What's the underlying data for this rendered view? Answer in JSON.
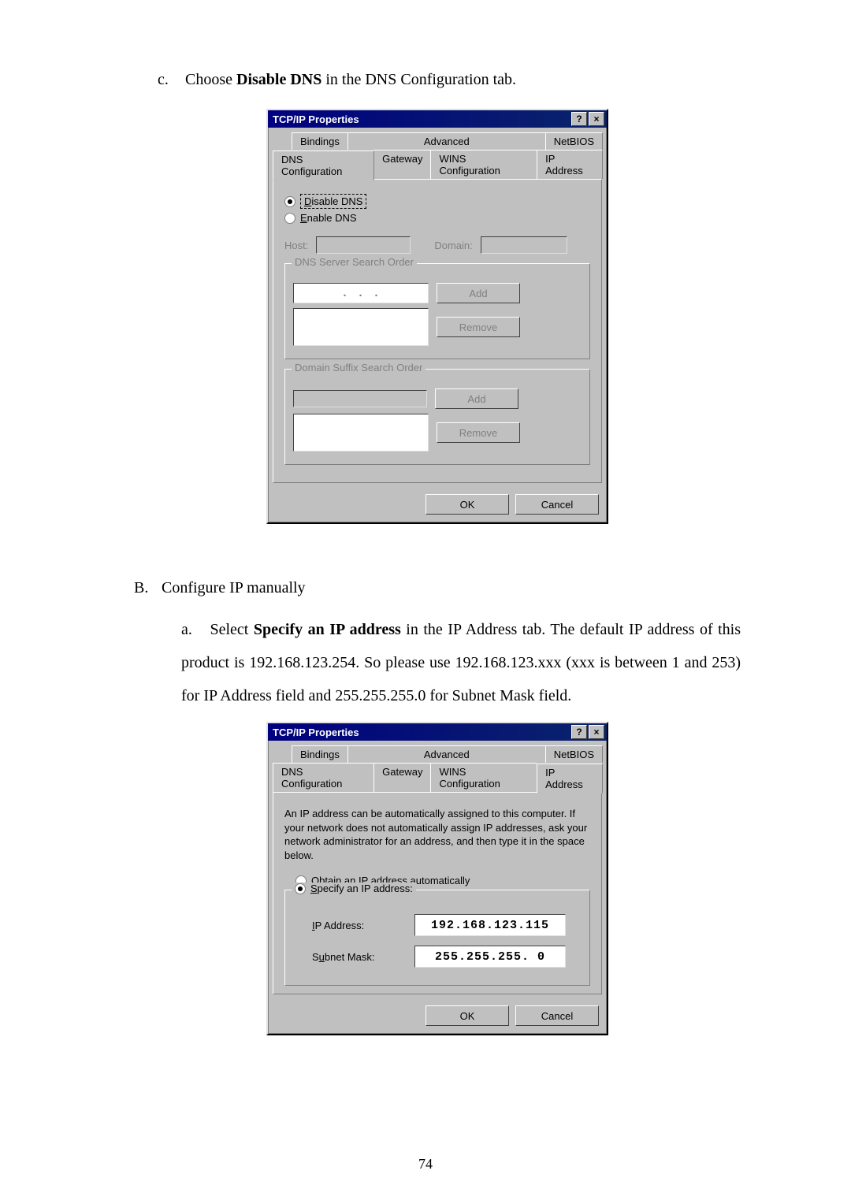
{
  "step_c": {
    "marker": "c.",
    "pre": "Choose ",
    "bold": "Disable DNS",
    "post": " in the DNS Configuration tab."
  },
  "dlg1": {
    "title": "TCP/IP Properties",
    "help_glyph": "?",
    "close_glyph": "×",
    "tabs_back": {
      "bindings": "Bindings",
      "advanced": "Advanced",
      "netbios": "NetBIOS"
    },
    "tabs_front": {
      "dns": "DNS Configuration",
      "gateway": "Gateway",
      "wins": "WINS Configuration",
      "ip": "IP Address"
    },
    "radio_disable": "Disable DNS",
    "radio_enable": "Enable DNS",
    "host_label": "Host:",
    "domain_label": "Domain:",
    "dns_order_legend": "DNS Server Search Order",
    "add_label": "Add",
    "remove_label": "Remove",
    "suffix_legend": "Domain Suffix Search Order",
    "ok": "OK",
    "cancel": "Cancel"
  },
  "section_b": {
    "marker": "B.",
    "title": "Configure IP manually",
    "a_marker": "a.",
    "a_pre": "Select ",
    "a_bold": "Specify an IP address",
    "a_post": " in the IP Address tab. The default IP address of this product is 192.168.123.254. So please use 192.168.123.xxx (xxx is between 1 and 253) for IP Address field and 255.255.255.0 for Subnet Mask field."
  },
  "dlg2": {
    "title": "TCP/IP Properties",
    "help_glyph": "?",
    "close_glyph": "×",
    "tabs_back": {
      "bindings": "Bindings",
      "advanced": "Advanced",
      "netbios": "NetBIOS"
    },
    "tabs_front": {
      "dns": "DNS Configuration",
      "gateway": "Gateway",
      "wins": "WINS Configuration",
      "ip": "IP Address"
    },
    "desc": "An IP address can be automatically assigned to this computer. If your network does not automatically assign IP addresses, ask your network administrator for an address, and then type it in the space below.",
    "radio_obtain": "Obtain an IP address automatically",
    "radio_specify": "Specify an IP address:",
    "ip_label": "IP Address:",
    "ip_value": "192.168.123.115",
    "mask_label": "Subnet Mask:",
    "mask_value": "255.255.255.  0",
    "ok": "OK",
    "cancel": "Cancel"
  },
  "page_number": "74"
}
